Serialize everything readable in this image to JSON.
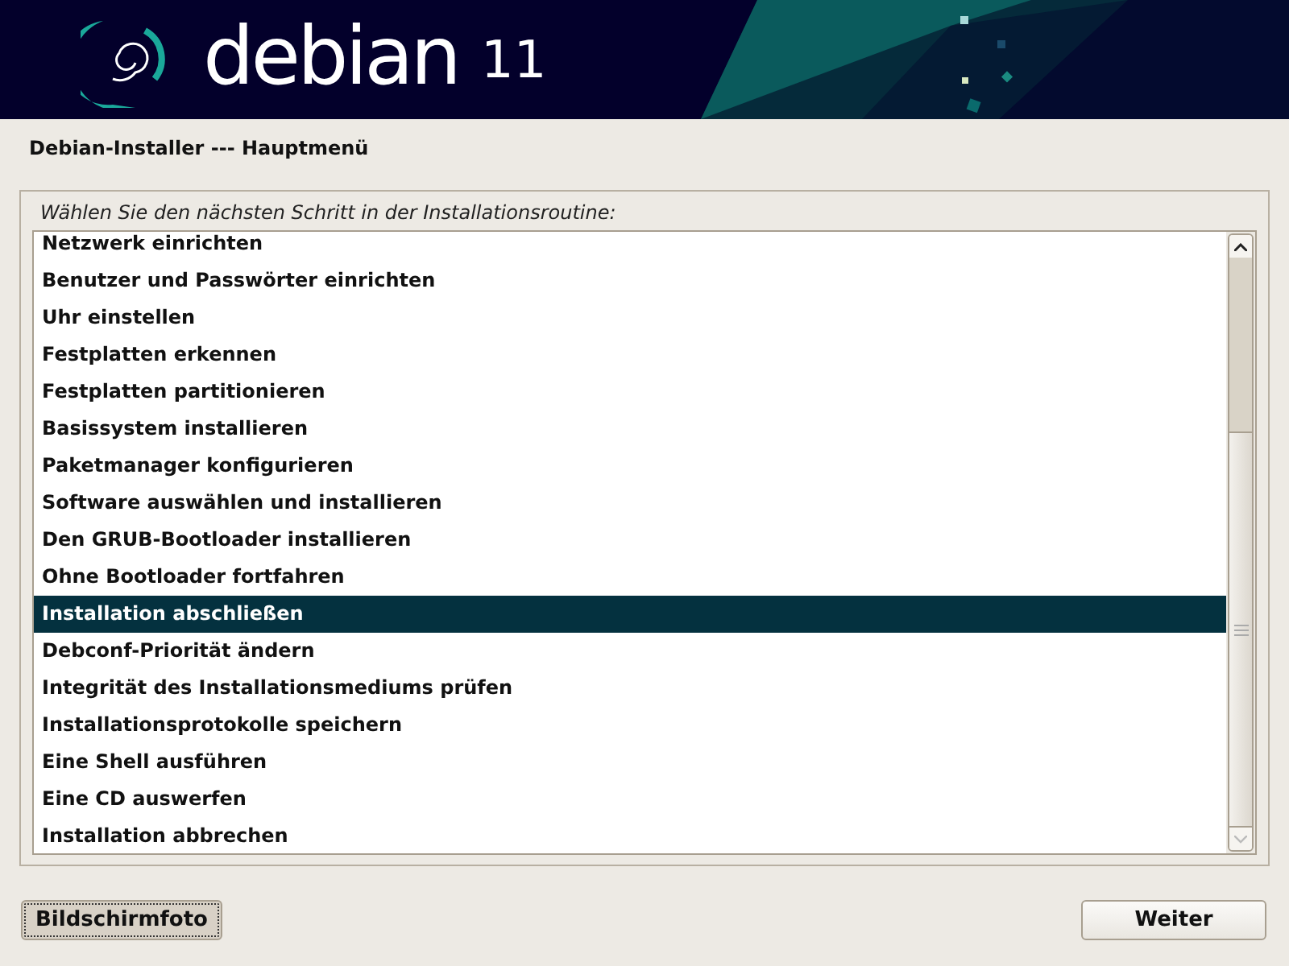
{
  "banner": {
    "logo_text": "debian",
    "version": "11"
  },
  "window": {
    "title": "Debian-Installer --- Hauptmenü"
  },
  "prompt": "Wählen Sie den nächsten Schritt in der Installationsroutine:",
  "menu_items": [
    {
      "label": "Netzwerk einrichten",
      "selected": false
    },
    {
      "label": "Benutzer und Passwörter einrichten",
      "selected": false
    },
    {
      "label": "Uhr einstellen",
      "selected": false
    },
    {
      "label": "Festplatten erkennen",
      "selected": false
    },
    {
      "label": "Festplatten partitionieren",
      "selected": false
    },
    {
      "label": "Basissystem installieren",
      "selected": false
    },
    {
      "label": "Paketmanager konfigurieren",
      "selected": false
    },
    {
      "label": "Software auswählen und installieren",
      "selected": false
    },
    {
      "label": "Den GRUB-Bootloader installieren",
      "selected": false
    },
    {
      "label": "Ohne Bootloader fortfahren",
      "selected": false
    },
    {
      "label": "Installation abschließen",
      "selected": true
    },
    {
      "label": "Debconf-Priorität ändern",
      "selected": false
    },
    {
      "label": "Integrität des Installationsmediums prüfen",
      "selected": false
    },
    {
      "label": "Installationsprotokolle speichern",
      "selected": false
    },
    {
      "label": "Eine Shell ausführen",
      "selected": false
    },
    {
      "label": "Eine CD auswerfen",
      "selected": false
    },
    {
      "label": "Installation abbrechen",
      "selected": false
    }
  ],
  "buttons": [
    {
      "label": "Bildschirmfoto",
      "focused": true
    },
    {
      "label": "Weiter",
      "focused": false
    }
  ]
}
